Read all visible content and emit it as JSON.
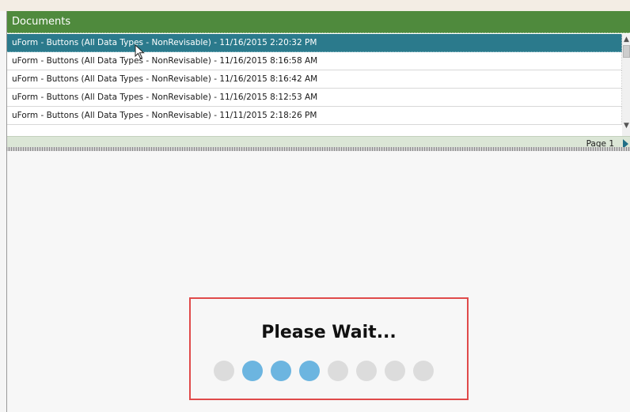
{
  "panel": {
    "title": "Documents"
  },
  "documents": [
    {
      "label": "uForm - Buttons (All Data Types - NonRevisable) - 11/16/2015 2:20:32 PM",
      "selected": true
    },
    {
      "label": "uForm - Buttons (All Data Types - NonRevisable) - 11/16/2015 8:16:58 AM",
      "selected": false
    },
    {
      "label": "uForm - Buttons (All Data Types - NonRevisable) - 11/16/2015 8:16:42 AM",
      "selected": false
    },
    {
      "label": "uForm - Buttons (All Data Types - NonRevisable) - 11/16/2015 8:12:53 AM",
      "selected": false
    },
    {
      "label": "uForm - Buttons (All Data Types - NonRevisable) - 11/11/2015 2:18:26 PM",
      "selected": false
    }
  ],
  "pager": {
    "label": "Page 1",
    "next_icon": "triangle-right-icon"
  },
  "loading": {
    "title": "Please Wait...",
    "dots_total": 8,
    "active_dots": [
      1,
      2,
      3
    ]
  },
  "colors": {
    "header_bg": "#4f8a3d",
    "selected_row_bg": "#2b7a8c",
    "dot_active": "#6cb5e0",
    "dot_inactive": "#dcdcdc",
    "highlight_border": "#e04a4a"
  }
}
